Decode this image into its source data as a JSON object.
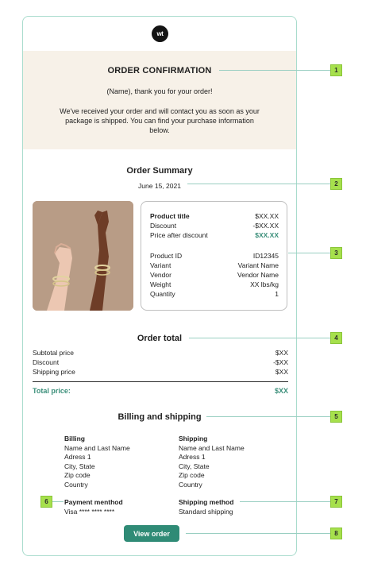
{
  "logo": {
    "text": "wt",
    "icon": "brand-logo-icon"
  },
  "hero": {
    "title": "ORDER CONFIRMATION",
    "thanks": "(Name), thank you for your order!",
    "message": "We've received your order and will contact you as soon as your package is shipped. You can find your purchase information below."
  },
  "summary": {
    "title": "Order Summary",
    "date": "June 15, 2021"
  },
  "product": {
    "image_alt": "hands-with-bracelets-image",
    "rows": [
      {
        "label": "Product title",
        "value": "$XX.XX"
      },
      {
        "label": "Discount",
        "value": "-$XX.XX"
      },
      {
        "label": "Price after discount",
        "value": "$XX.XX"
      },
      {
        "label": "Product ID",
        "value": "ID12345"
      },
      {
        "label": "Variant",
        "value": "Variant Name"
      },
      {
        "label": "Vendor",
        "value": "Vendor Name"
      },
      {
        "label": "Weight",
        "value": "XX lbs/kg"
      },
      {
        "label": "Quantity",
        "value": "1"
      }
    ]
  },
  "order_total": {
    "title": "Order total",
    "rows": [
      {
        "label": "Subtotal price",
        "value": "$XX"
      },
      {
        "label": "Discount",
        "value": "-$XX"
      },
      {
        "label": "Shipping price",
        "value": "$XX"
      }
    ],
    "total_label": "Total price:",
    "total_value": "$XX"
  },
  "billing_shipping": {
    "title": "Billing and shipping",
    "billing": {
      "heading": "Billing",
      "lines": [
        "Name and Last Name",
        "Adress 1",
        "City, State",
        "Zip code",
        "Country"
      ]
    },
    "shipping": {
      "heading": "Shipping",
      "lines": [
        "Name and Last Name",
        "Adress 1",
        "City, State",
        "Zip code",
        "Country"
      ]
    },
    "payment": {
      "heading": "Payment menthod",
      "value": "Visa **** **** ****"
    },
    "shipping_method": {
      "heading": "Shipping method",
      "value": "Standard shipping"
    }
  },
  "button": {
    "label": "View order"
  },
  "callouts": [
    "1",
    "2",
    "3",
    "4",
    "5",
    "6",
    "7",
    "8"
  ],
  "colors": {
    "accent": "#2f8b76",
    "hero_bg": "#f7f1e8",
    "badge": "#a6e04c",
    "border": "#a9dccd"
  }
}
